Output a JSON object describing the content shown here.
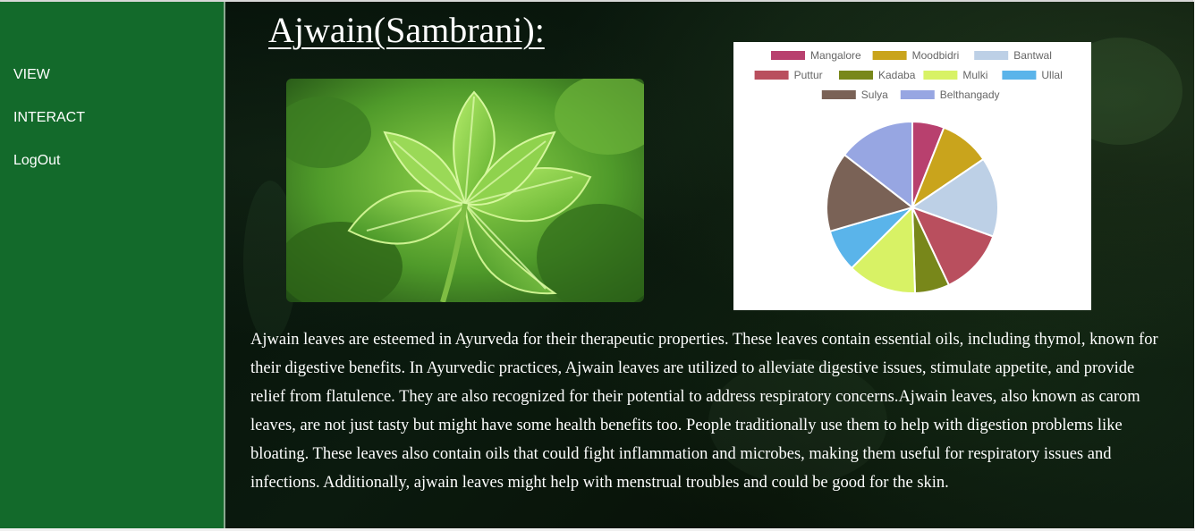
{
  "sidebar": {
    "items": [
      {
        "label": "VIEW"
      },
      {
        "label": "INTERACT"
      },
      {
        "label": "LogOut"
      }
    ]
  },
  "page": {
    "title": "Ajwain(Sambrani):",
    "description": "Ajwain leaves are esteemed in Ayurveda for their therapeutic properties. These leaves contain essential oils, including thymol, known for their digestive benefits. In Ayurvedic practices, Ajwain leaves are utilized to alleviate digestive issues, stimulate appetite, and provide relief from flatulence. They are also recognized for their potential to address respiratory concerns.Ajwain leaves, also known as carom leaves, are not just tasty but might have some health benefits too. People traditionally use them to help with digestion problems like bloating. These leaves also contain oils that could fight inflammation and microbes, making them useful for respiratory issues and infections. Additionally, ajwain leaves might help with menstrual troubles and could be good for the skin."
  },
  "colors": {
    "sidebar_bg": "#136a2b",
    "nav_text": "#ffffff",
    "title_text": "#ffffff"
  },
  "icons": {
    "photo": "ajwain-leaf-photo"
  },
  "chart_data": {
    "type": "pie",
    "legend_position": "top",
    "labels": [
      "Mangalore",
      "Moodbidri",
      "Bantwal",
      "Puttur",
      "Kadaba",
      "Mulki",
      "Ullal",
      "Sulya",
      "Belthangady"
    ],
    "values": [
      6,
      9.5,
      15,
      12.5,
      6.5,
      13,
      8,
      15,
      14.5
    ],
    "colors": [
      "#b8406e",
      "#c9a41c",
      "#bdd0e6",
      "#b94f5e",
      "#78871a",
      "#d8f265",
      "#5ab4ea",
      "#7a6256",
      "#97a6e2"
    ]
  }
}
